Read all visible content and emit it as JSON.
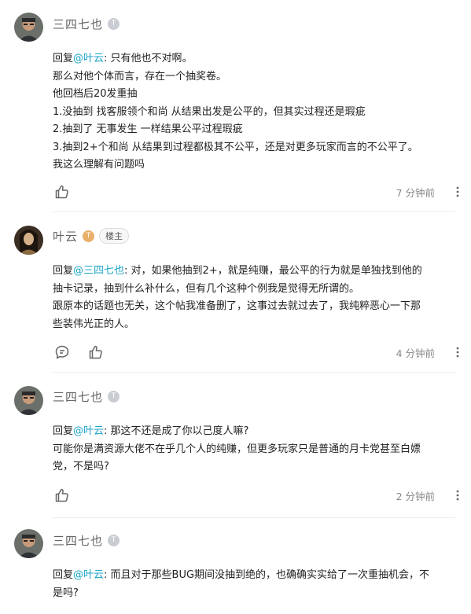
{
  "comments": [
    {
      "username": "三四七也",
      "level_badge": "T",
      "reply_prefix": "回复",
      "reply_mention": "@叶云",
      "reply_colon": ": ",
      "lines": [
        "只有他也不对啊。",
        "那么对他个体而言，存在一个抽奖卷。",
        "他回档后20发重抽",
        "1.没抽到 找客服领个和尚 从结果出发是公平的，但其实过程还是瑕疵",
        "2.抽到了 无事发生 一样结果公平过程瑕疵",
        "3.抽到2+个和尚 从结果到过程都极其不公平，还是对更多玩家而言的不公平了。",
        "我这么理解有问题吗"
      ],
      "timestamp": "7 分钟前"
    },
    {
      "username": "叶云",
      "level_badge": "T",
      "op_badge": "楼主",
      "reply_prefix": "回复",
      "reply_mention": "@三四七也",
      "reply_colon": ": ",
      "lines": [
        "对，如果他抽到2+，就是纯赚，最公平的行为就是单独找到他的",
        "抽卡记录，抽到什么补什么，但有几个这种个例我是觉得无所谓的。",
        "跟原本的话题也无关，这个帖我准备删了，这事过去就过去了，我纯粹恶心一下那",
        "些装伟光正的人。"
      ],
      "timestamp": "4 分钟前"
    },
    {
      "username": "三四七也",
      "level_badge": "T",
      "reply_prefix": "回复",
      "reply_mention": "@叶云",
      "reply_colon": ": ",
      "lines": [
        "那这不还是成了你以己度人嘛?",
        "可能你是满资源大佬不在乎几个人的纯赚，但更多玩家只是普通的月卡党甚至白嫖",
        "党，不是吗?"
      ],
      "timestamp": "2 分钟前"
    },
    {
      "username": "三四七也",
      "level_badge": "T",
      "reply_prefix": "回复",
      "reply_mention": "@叶云",
      "reply_colon": ": ",
      "lines": [
        "而且对于那些BUG期间没抽到绝的，也确确实实给了一次重抽机会，不",
        "是吗?"
      ]
    }
  ],
  "icons": {
    "like": "thumbs-up-icon",
    "reply": "comment-bubble-icon",
    "more": "more-vertical-icon"
  },
  "colors": {
    "mention": "#1aa5c7",
    "username": "#666666",
    "timestamp": "#888888",
    "divider": "#eceef1"
  }
}
